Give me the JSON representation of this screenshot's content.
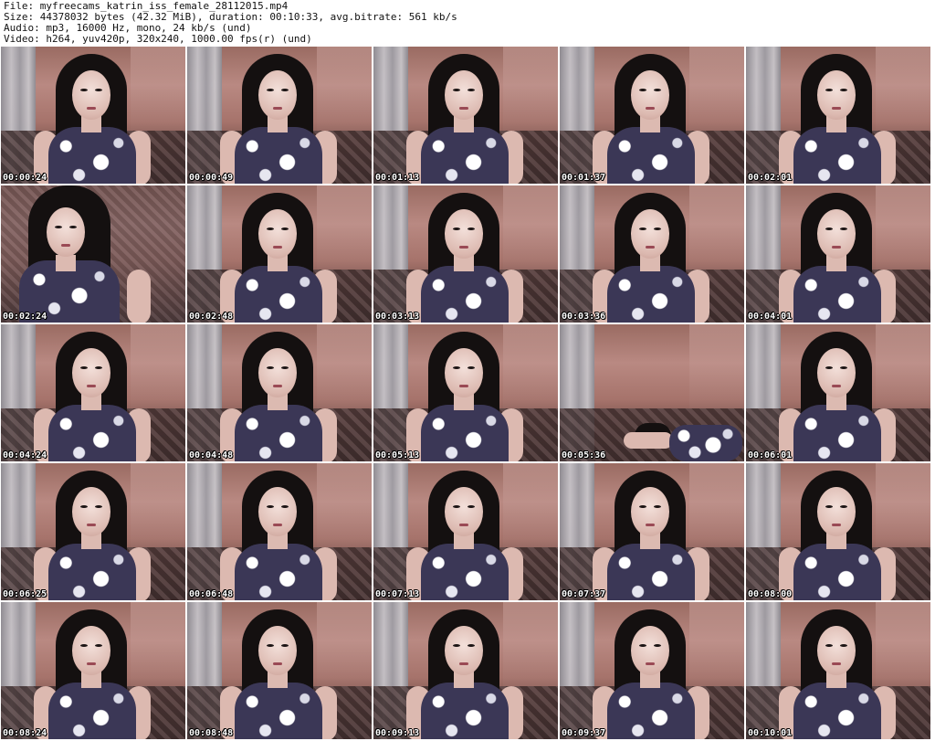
{
  "header": {
    "file": "File: myfreecams_katrin_iss_female_28112015.mp4",
    "size": "Size: 44378032 bytes (42.32 MiB), duration: 00:10:33, avg.bitrate: 561 kb/s",
    "audio": "Audio: mp3, 16000 Hz, mono, 24 kb/s (und)",
    "video": "Video: h264, yuv420p, 320x240, 1000.00 fps(r) (und)"
  },
  "frames": [
    {
      "timestamp": "00:00:24"
    },
    {
      "timestamp": "00:00:49"
    },
    {
      "timestamp": "00:01:13"
    },
    {
      "timestamp": "00:01:37"
    },
    {
      "timestamp": "00:02:01"
    },
    {
      "timestamp": "00:02:24"
    },
    {
      "timestamp": "00:02:48"
    },
    {
      "timestamp": "00:03:13"
    },
    {
      "timestamp": "00:03:36"
    },
    {
      "timestamp": "00:04:01"
    },
    {
      "timestamp": "00:04:24"
    },
    {
      "timestamp": "00:04:48"
    },
    {
      "timestamp": "00:05:13"
    },
    {
      "timestamp": "00:05:36"
    },
    {
      "timestamp": "00:06:01"
    },
    {
      "timestamp": "00:06:25"
    },
    {
      "timestamp": "00:06:48"
    },
    {
      "timestamp": "00:07:13"
    },
    {
      "timestamp": "00:07:37"
    },
    {
      "timestamp": "00:08:00"
    },
    {
      "timestamp": "00:08:24"
    },
    {
      "timestamp": "00:08:48"
    },
    {
      "timestamp": "00:09:13"
    },
    {
      "timestamp": "00:09:37"
    },
    {
      "timestamp": "00:10:01"
    }
  ]
}
